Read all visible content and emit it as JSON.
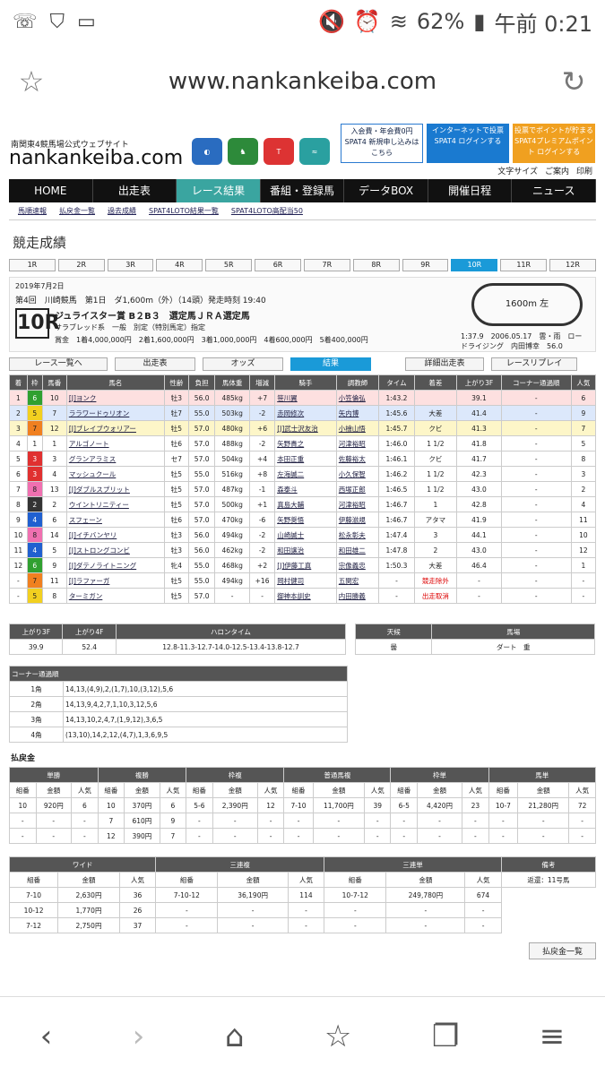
{
  "status": {
    "battery": "62%",
    "time": "午前 0:21"
  },
  "browser": {
    "url": "www.nankankeiba.com"
  },
  "site": {
    "subtitle": "南関東4競馬場公式ウェブサイト",
    "logo": "nankankeiba.com",
    "banner1": "入会費・年会費0円 SPAT4 新規申し込みはこちら",
    "banner2": "インターネットで投票 SPAT4 ログインする",
    "banner3": "投票でポイントが貯まる SPAT4プレミアムポイント ログインする",
    "tools": [
      "文字サイズ",
      "ご案内",
      "印刷"
    ]
  },
  "gnav": [
    "HOME",
    "出走表",
    "レース結果",
    "番組・登録馬",
    "データBOX",
    "開催日程",
    "ニュース"
  ],
  "snav": [
    "馬順速報",
    "払戻金一覧",
    "過去成績",
    "SPAT4LOTO結果一覧",
    "SPAT4LOTO高配当50"
  ],
  "page_title": "競走成績",
  "race_tabs": [
    "1R",
    "2R",
    "3R",
    "4R",
    "5R",
    "6R",
    "7R",
    "8R",
    "9R",
    "10R",
    "11R",
    "12R"
  ],
  "race": {
    "date": "2019年7月2日",
    "meet": "第4回　川崎競馬　第1日　ダ1,600m（外）（14頭）発走時刻 19:40",
    "number": "10R",
    "name": "ジュライスター賞 B２B３　選定馬ＪＲＡ選定馬",
    "cond": "サラブレッド系　一般　別定（特別馬定）指定",
    "prize": "賞金　1着4,000,000円　2着1,600,000円　3着1,000,000円　4着600,000円　5着400,000円",
    "course": "1600m 左",
    "record": "1:37.9　2006.05.17　雲・雨　ロードライジング　内田博幸　56.0"
  },
  "buttons": {
    "back": "レース一覧へ",
    "entries": "出走表",
    "odds": "オッズ",
    "result": "結果",
    "detail": "詳細出走表",
    "replay": "レースリプレイ"
  },
  "result_headers": [
    "着",
    "枠",
    "馬番",
    "馬名",
    "性齢",
    "負担",
    "馬体重",
    "増減",
    "騎手",
    "調教師",
    "タイム",
    "着差",
    "上がり3F",
    "コーナー通過順",
    "人気"
  ],
  "results": [
    [
      "1",
      "6",
      "10",
      "[J]ヨンク",
      "牡3",
      "56.0",
      "485kg",
      "+7",
      "笹川翼",
      "小笠倫弘",
      "1:43.2",
      "",
      "39.1",
      "-",
      "6"
    ],
    [
      "2",
      "5",
      "7",
      "ララワードゥリオン",
      "牡7",
      "55.0",
      "503kg",
      "-2",
      "赤岡修次",
      "矢内博",
      "1:45.6",
      "大差",
      "41.4",
      "-",
      "9"
    ],
    [
      "3",
      "7",
      "12",
      "[J]ブレイブウォリアー",
      "牡5",
      "57.0",
      "480kg",
      "+6",
      "[J]武士沢友治",
      "小檜山悟",
      "1:45.7",
      "クビ",
      "41.3",
      "-",
      "7"
    ],
    [
      "4",
      "1",
      "1",
      "アルゴノート",
      "牡6",
      "57.0",
      "488kg",
      "-2",
      "矢野貴之",
      "河津裕昭",
      "1:46.0",
      "1 1/2",
      "41.8",
      "-",
      "5"
    ],
    [
      "5",
      "3",
      "3",
      "グランアラミス",
      "セ7",
      "57.0",
      "504kg",
      "+4",
      "本田正重",
      "佐藤裕太",
      "1:46.1",
      "クビ",
      "41.7",
      "-",
      "8"
    ],
    [
      "6",
      "3",
      "4",
      "マッシュクール",
      "牡5",
      "55.0",
      "516kg",
      "+8",
      "左海誠二",
      "小久保智",
      "1:46.2",
      "1 1/2",
      "42.3",
      "-",
      "3"
    ],
    [
      "7",
      "8",
      "13",
      "[J]ダブルスプリット",
      "牡5",
      "57.0",
      "487kg",
      "-1",
      "森泰斗",
      "西塚正郎",
      "1:46.5",
      "1 1/2",
      "43.0",
      "-",
      "2"
    ],
    [
      "8",
      "2",
      "2",
      "ウイントリニティー",
      "牡5",
      "57.0",
      "500kg",
      "+1",
      "真島大輔",
      "河津裕昭",
      "1:46.7",
      "1",
      "42.8",
      "-",
      "4"
    ],
    [
      "9",
      "4",
      "6",
      "スフェーン",
      "牡6",
      "57.0",
      "470kg",
      "-6",
      "矢野奨悟",
      "伊藤滋規",
      "1:46.7",
      "アタマ",
      "41.9",
      "-",
      "11"
    ],
    [
      "10",
      "8",
      "14",
      "[J]イチバンヤリ",
      "牡3",
      "56.0",
      "494kg",
      "-2",
      "山崎誠士",
      "松永彰夫",
      "1:47.4",
      "3",
      "44.1",
      "-",
      "10"
    ],
    [
      "11",
      "4",
      "5",
      "[J]ストロングコンビ",
      "牡3",
      "56.0",
      "462kg",
      "-2",
      "和田譲治",
      "和田雄二",
      "1:47.8",
      "2",
      "43.0",
      "-",
      "12"
    ],
    [
      "12",
      "6",
      "9",
      "[J]ダテノライトニング",
      "牝4",
      "55.0",
      "468kg",
      "+2",
      "[J]伊藤工真",
      "宗像義忠",
      "1:50.3",
      "大差",
      "46.4",
      "-",
      "1"
    ],
    [
      "-",
      "7",
      "11",
      "[J]ラファーガ",
      "牡5",
      "55.0",
      "494kg",
      "+16",
      "岡村健司",
      "五関宏",
      "-",
      "競走除外",
      "-",
      "-",
      "-"
    ],
    [
      "-",
      "5",
      "8",
      "ターミガン",
      "牡5",
      "57.0",
      "-",
      "-",
      "御神本訓史",
      "内田勝義",
      "-",
      "出走取消",
      "-",
      "-",
      "-"
    ]
  ],
  "lap": {
    "h3f": "上がり3F",
    "h4f": "上がり4F",
    "hfurlong": "ハロンタイム",
    "v3f": "39.9",
    "v4f": "52.4",
    "furlong": "12.8-11.3-12.7-14.0-12.5-13.4-13.8-12.7",
    "hweather": "天候",
    "htrack": "馬場",
    "weather": "曇",
    "track": "ダート　重"
  },
  "corner": {
    "title": "コーナー通過順",
    "rows": [
      [
        "1角",
        "14,13,(4,9),2,(1,7),10,(3,12),5,6"
      ],
      [
        "2角",
        "14,13,9,4,2,7,1,10,3,12,5,6"
      ],
      [
        "3角",
        "14,13,10,2,4,7,(1,9,12),3,6,5"
      ],
      [
        "4角",
        "(13,10),14,2,12,(4,7),1,3,6,9,5"
      ]
    ]
  },
  "payout_title": "払戻金",
  "pay1": {
    "groups": [
      "単勝",
      "複勝",
      "枠複",
      "普通馬複",
      "枠単",
      "馬単"
    ],
    "sub": [
      "組番",
      "金額",
      "人気",
      "組番",
      "金額",
      "人気",
      "組番",
      "金額",
      "人気",
      "組番",
      "金額",
      "人気",
      "組番",
      "金額",
      "人気",
      "組番",
      "金額",
      "人気"
    ],
    "rows": [
      [
        "10",
        "920円",
        "6",
        "10",
        "370円",
        "6",
        "5-6",
        "2,390円",
        "12",
        "7-10",
        "11,700円",
        "39",
        "6-5",
        "4,420円",
        "23",
        "10-7",
        "21,280円",
        "72"
      ],
      [
        "-",
        "-",
        "-",
        "7",
        "610円",
        "9",
        "-",
        "-",
        "-",
        "-",
        "-",
        "-",
        "-",
        "-",
        "-",
        "-",
        "-",
        "-"
      ],
      [
        "-",
        "-",
        "-",
        "12",
        "390円",
        "7",
        "-",
        "-",
        "-",
        "-",
        "-",
        "-",
        "-",
        "-",
        "-",
        "-",
        "-",
        "-"
      ]
    ]
  },
  "pay2": {
    "groups": [
      "ワイド",
      "三連複",
      "三連単",
      "備考"
    ],
    "sub": [
      "組番",
      "金額",
      "人気",
      "組番",
      "金額",
      "人気",
      "組番",
      "金額",
      "人気"
    ],
    "rows": [
      [
        "7-10",
        "2,630円",
        "36",
        "7-10-12",
        "36,190円",
        "114",
        "10-7-12",
        "249,780円",
        "674"
      ],
      [
        "10-12",
        "1,770円",
        "26",
        "-",
        "-",
        "-",
        "-",
        "-",
        "-"
      ],
      [
        "7-12",
        "2,750円",
        "37",
        "-",
        "-",
        "-",
        "-",
        "-",
        "-"
      ]
    ],
    "note": "返還：11号馬"
  },
  "payout_list_btn": "払戻金一覧",
  "colors": {
    "frame1": "#ffffff",
    "frame2": "#333333",
    "frame3": "#e03030",
    "frame4": "#2060d0",
    "frame5": "#f2d020",
    "frame6": "#30a030",
    "frame7": "#f08020",
    "frame8": "#f070b0"
  }
}
